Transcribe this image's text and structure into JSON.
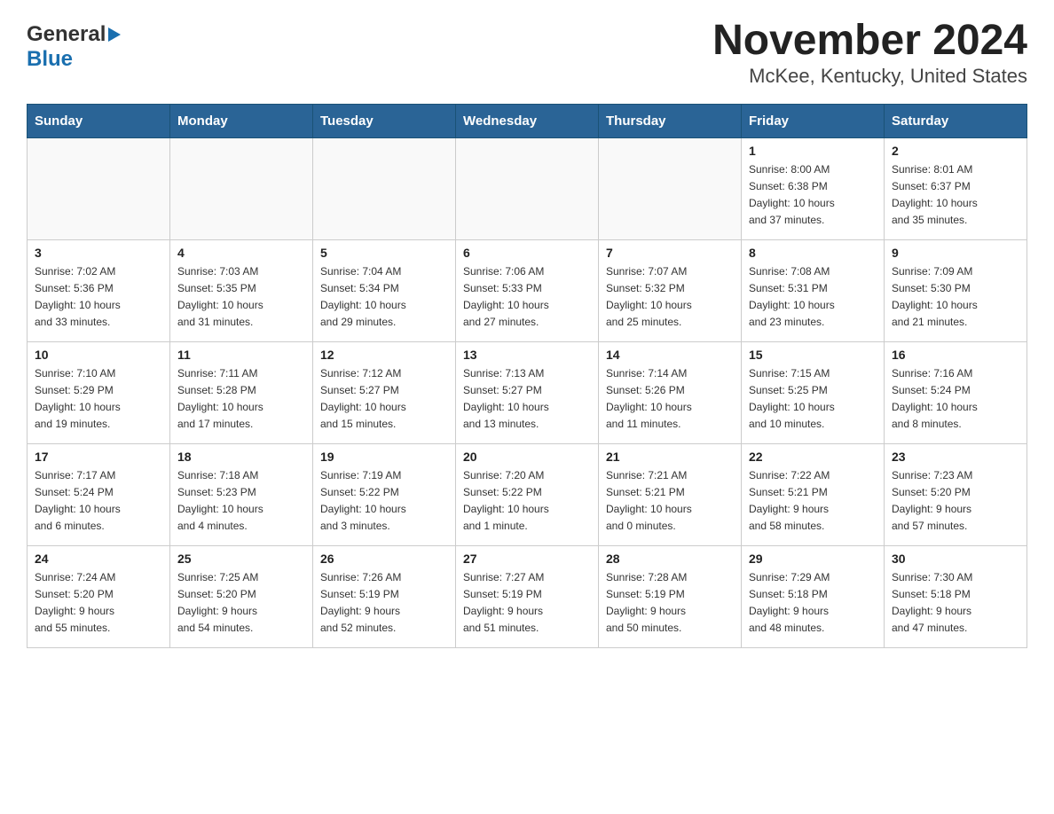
{
  "header": {
    "title": "November 2024",
    "subtitle": "McKee, Kentucky, United States",
    "logo_general": "General",
    "logo_blue": "Blue"
  },
  "days_of_week": [
    "Sunday",
    "Monday",
    "Tuesday",
    "Wednesday",
    "Thursday",
    "Friday",
    "Saturday"
  ],
  "weeks": [
    {
      "days": [
        {
          "num": "",
          "info": ""
        },
        {
          "num": "",
          "info": ""
        },
        {
          "num": "",
          "info": ""
        },
        {
          "num": "",
          "info": ""
        },
        {
          "num": "",
          "info": ""
        },
        {
          "num": "1",
          "info": "Sunrise: 8:00 AM\nSunset: 6:38 PM\nDaylight: 10 hours\nand 37 minutes."
        },
        {
          "num": "2",
          "info": "Sunrise: 8:01 AM\nSunset: 6:37 PM\nDaylight: 10 hours\nand 35 minutes."
        }
      ]
    },
    {
      "days": [
        {
          "num": "3",
          "info": "Sunrise: 7:02 AM\nSunset: 5:36 PM\nDaylight: 10 hours\nand 33 minutes."
        },
        {
          "num": "4",
          "info": "Sunrise: 7:03 AM\nSunset: 5:35 PM\nDaylight: 10 hours\nand 31 minutes."
        },
        {
          "num": "5",
          "info": "Sunrise: 7:04 AM\nSunset: 5:34 PM\nDaylight: 10 hours\nand 29 minutes."
        },
        {
          "num": "6",
          "info": "Sunrise: 7:06 AM\nSunset: 5:33 PM\nDaylight: 10 hours\nand 27 minutes."
        },
        {
          "num": "7",
          "info": "Sunrise: 7:07 AM\nSunset: 5:32 PM\nDaylight: 10 hours\nand 25 minutes."
        },
        {
          "num": "8",
          "info": "Sunrise: 7:08 AM\nSunset: 5:31 PM\nDaylight: 10 hours\nand 23 minutes."
        },
        {
          "num": "9",
          "info": "Sunrise: 7:09 AM\nSunset: 5:30 PM\nDaylight: 10 hours\nand 21 minutes."
        }
      ]
    },
    {
      "days": [
        {
          "num": "10",
          "info": "Sunrise: 7:10 AM\nSunset: 5:29 PM\nDaylight: 10 hours\nand 19 minutes."
        },
        {
          "num": "11",
          "info": "Sunrise: 7:11 AM\nSunset: 5:28 PM\nDaylight: 10 hours\nand 17 minutes."
        },
        {
          "num": "12",
          "info": "Sunrise: 7:12 AM\nSunset: 5:27 PM\nDaylight: 10 hours\nand 15 minutes."
        },
        {
          "num": "13",
          "info": "Sunrise: 7:13 AM\nSunset: 5:27 PM\nDaylight: 10 hours\nand 13 minutes."
        },
        {
          "num": "14",
          "info": "Sunrise: 7:14 AM\nSunset: 5:26 PM\nDaylight: 10 hours\nand 11 minutes."
        },
        {
          "num": "15",
          "info": "Sunrise: 7:15 AM\nSunset: 5:25 PM\nDaylight: 10 hours\nand 10 minutes."
        },
        {
          "num": "16",
          "info": "Sunrise: 7:16 AM\nSunset: 5:24 PM\nDaylight: 10 hours\nand 8 minutes."
        }
      ]
    },
    {
      "days": [
        {
          "num": "17",
          "info": "Sunrise: 7:17 AM\nSunset: 5:24 PM\nDaylight: 10 hours\nand 6 minutes."
        },
        {
          "num": "18",
          "info": "Sunrise: 7:18 AM\nSunset: 5:23 PM\nDaylight: 10 hours\nand 4 minutes."
        },
        {
          "num": "19",
          "info": "Sunrise: 7:19 AM\nSunset: 5:22 PM\nDaylight: 10 hours\nand 3 minutes."
        },
        {
          "num": "20",
          "info": "Sunrise: 7:20 AM\nSunset: 5:22 PM\nDaylight: 10 hours\nand 1 minute."
        },
        {
          "num": "21",
          "info": "Sunrise: 7:21 AM\nSunset: 5:21 PM\nDaylight: 10 hours\nand 0 minutes."
        },
        {
          "num": "22",
          "info": "Sunrise: 7:22 AM\nSunset: 5:21 PM\nDaylight: 9 hours\nand 58 minutes."
        },
        {
          "num": "23",
          "info": "Sunrise: 7:23 AM\nSunset: 5:20 PM\nDaylight: 9 hours\nand 57 minutes."
        }
      ]
    },
    {
      "days": [
        {
          "num": "24",
          "info": "Sunrise: 7:24 AM\nSunset: 5:20 PM\nDaylight: 9 hours\nand 55 minutes."
        },
        {
          "num": "25",
          "info": "Sunrise: 7:25 AM\nSunset: 5:20 PM\nDaylight: 9 hours\nand 54 minutes."
        },
        {
          "num": "26",
          "info": "Sunrise: 7:26 AM\nSunset: 5:19 PM\nDaylight: 9 hours\nand 52 minutes."
        },
        {
          "num": "27",
          "info": "Sunrise: 7:27 AM\nSunset: 5:19 PM\nDaylight: 9 hours\nand 51 minutes."
        },
        {
          "num": "28",
          "info": "Sunrise: 7:28 AM\nSunset: 5:19 PM\nDaylight: 9 hours\nand 50 minutes."
        },
        {
          "num": "29",
          "info": "Sunrise: 7:29 AM\nSunset: 5:18 PM\nDaylight: 9 hours\nand 48 minutes."
        },
        {
          "num": "30",
          "info": "Sunrise: 7:30 AM\nSunset: 5:18 PM\nDaylight: 9 hours\nand 47 minutes."
        }
      ]
    }
  ]
}
